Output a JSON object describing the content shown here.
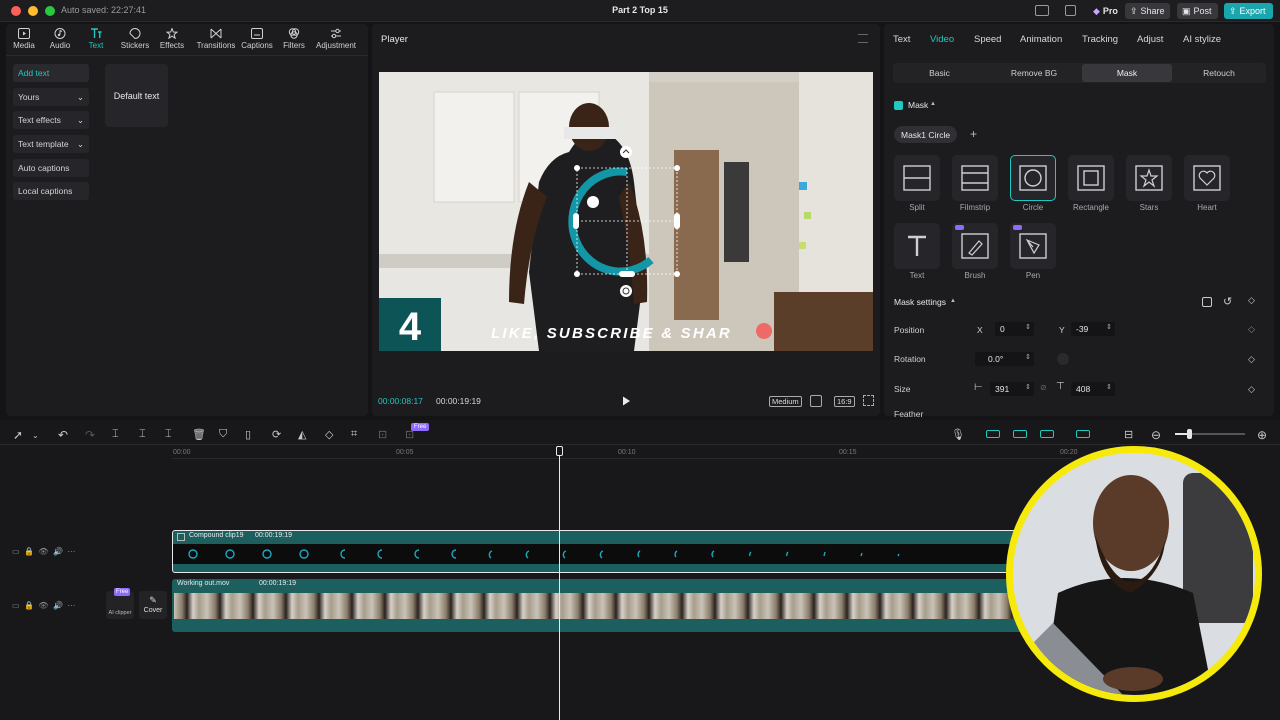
{
  "titlebar": {
    "autosave": "Auto saved: 22:27:41",
    "project": "Part 2 Top 15",
    "pro_label": "Pro",
    "share_label": "Share",
    "post_label": "Post",
    "export_label": "Export"
  },
  "toolbar": {
    "tabs": [
      {
        "label": "Media",
        "icon": "media-icon"
      },
      {
        "label": "Audio",
        "icon": "audio-icon"
      },
      {
        "label": "Text",
        "icon": "text-icon"
      },
      {
        "label": "Stickers",
        "icon": "stickers-icon"
      },
      {
        "label": "Effects",
        "icon": "effects-icon"
      },
      {
        "label": "Transitions",
        "icon": "transitions-icon"
      },
      {
        "label": "Captions",
        "icon": "captions-icon"
      },
      {
        "label": "Filters",
        "icon": "filters-icon"
      },
      {
        "label": "Adjustment",
        "icon": "adjustment-icon"
      }
    ],
    "active": "Text"
  },
  "left_menu": {
    "items": [
      "Add text",
      "Yours",
      "Text effects",
      "Text template",
      "Auto captions",
      "Local captions"
    ],
    "default_text_card": "Default text"
  },
  "player": {
    "title": "Player",
    "overlay_number": "4",
    "overlay_text": "LIKE, SUBSCRIBE & SHAR",
    "current_time": "00:00:08:17",
    "total_time": "00:00:19:19",
    "quality": "Medium",
    "ratio": "16:9"
  },
  "inspector": {
    "tabs": [
      "Text",
      "Video",
      "Speed",
      "Animation",
      "Tracking",
      "Adjust",
      "AI stylize"
    ],
    "active_tab": "Video",
    "subtabs": [
      "Basic",
      "Remove BG",
      "Mask",
      "Retouch"
    ],
    "active_subtab": "Mask",
    "mask_section": "Mask",
    "mask_chip": "Mask1 Circle",
    "shapes": [
      {
        "label": "Split",
        "icon": "split-mask-icon"
      },
      {
        "label": "Filmstrip",
        "icon": "filmstrip-mask-icon"
      },
      {
        "label": "Circle",
        "icon": "circle-mask-icon"
      },
      {
        "label": "Rectangle",
        "icon": "rectangle-mask-icon"
      },
      {
        "label": "Stars",
        "icon": "stars-mask-icon"
      },
      {
        "label": "Heart",
        "icon": "heart-mask-icon"
      },
      {
        "label": "Text",
        "icon": "text-mask-icon"
      },
      {
        "label": "Brush",
        "icon": "brush-mask-icon"
      },
      {
        "label": "Pen",
        "icon": "pen-mask-icon"
      }
    ],
    "selected_shape": "Circle",
    "settings_title": "Mask settings",
    "position_label": "Position",
    "x_label": "X",
    "x_value": "0",
    "y_label": "Y",
    "y_value": "-39",
    "rotation_label": "Rotation",
    "rotation_value": "0.0°",
    "size_label": "Size",
    "width_value": "391",
    "height_value": "408",
    "feather_label": "Feather"
  },
  "timeline": {
    "ruler": [
      "00:00",
      "00:05",
      "00:10",
      "00:15",
      "00:20"
    ],
    "compound_clip": {
      "name": "Compound clip19",
      "duration": "00:00:19:19"
    },
    "video_clip": {
      "name": "Working out.mov",
      "duration": "00:00:19:19"
    },
    "free_badge": "Free",
    "ai_clipper": "AI clipper",
    "cover": "Cover"
  },
  "colors": {
    "accent": "#1fc8c0",
    "export": "#1ba6ad",
    "clip": "#1d5f5e",
    "webcam_ring": "#f6ea0c"
  }
}
